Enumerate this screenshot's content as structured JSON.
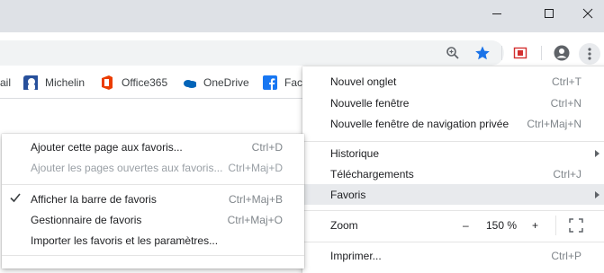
{
  "colors": {
    "titlebar": "#dee1e6",
    "omnibox": "#f1f3f4",
    "star": "#1a73e8",
    "highlight": "#e8eaed",
    "office": "#eb3c00",
    "onedrive": "#0364b8",
    "facebook": "#1877f2"
  },
  "window": {
    "minimize_icon": "minimize-icon",
    "maximize_icon": "maximize-icon",
    "close_icon": "close-icon"
  },
  "toolbar": {
    "icons": [
      "zoom-icon",
      "bookmark-star-icon",
      "extension-icon",
      "profile-icon",
      "chrome-menu-icon"
    ]
  },
  "bookmarks": {
    "items": [
      {
        "label": "ail",
        "icon": "none"
      },
      {
        "label": "Michelin",
        "icon": "michelin-icon"
      },
      {
        "label": "Office365",
        "icon": "office365-icon"
      },
      {
        "label": "OneDrive",
        "icon": "onedrive-icon"
      },
      {
        "label": "Fac",
        "icon": "facebook-icon"
      }
    ]
  },
  "main_menu": {
    "new_tab": {
      "label": "Nouvel onglet",
      "shortcut": "Ctrl+T"
    },
    "new_window": {
      "label": "Nouvelle fenêtre",
      "shortcut": "Ctrl+N"
    },
    "incognito": {
      "label": "Nouvelle fenêtre de navigation privée",
      "shortcut": "Ctrl+Maj+N"
    },
    "history": {
      "label": "Historique"
    },
    "downloads": {
      "label": "Téléchargements",
      "shortcut": "Ctrl+J"
    },
    "bookmarks": {
      "label": "Favoris"
    },
    "zoom": {
      "label": "Zoom",
      "minus": "–",
      "value": "150 %",
      "plus": "+"
    },
    "print": {
      "label": "Imprimer...",
      "shortcut": "Ctrl+P"
    }
  },
  "sub_menu": {
    "add_page": {
      "label": "Ajouter cette page aux favoris...",
      "shortcut": "Ctrl+D"
    },
    "add_open_pages": {
      "label": "Ajouter les pages ouvertes aux favoris...",
      "shortcut": "Ctrl+Maj+D"
    },
    "show_bar": {
      "label": "Afficher la barre de favoris",
      "shortcut": "Ctrl+Maj+B",
      "checked": true
    },
    "manager": {
      "label": "Gestionnaire de favoris",
      "shortcut": "Ctrl+Maj+O"
    },
    "import": {
      "label": "Importer les favoris et les paramètres..."
    }
  }
}
